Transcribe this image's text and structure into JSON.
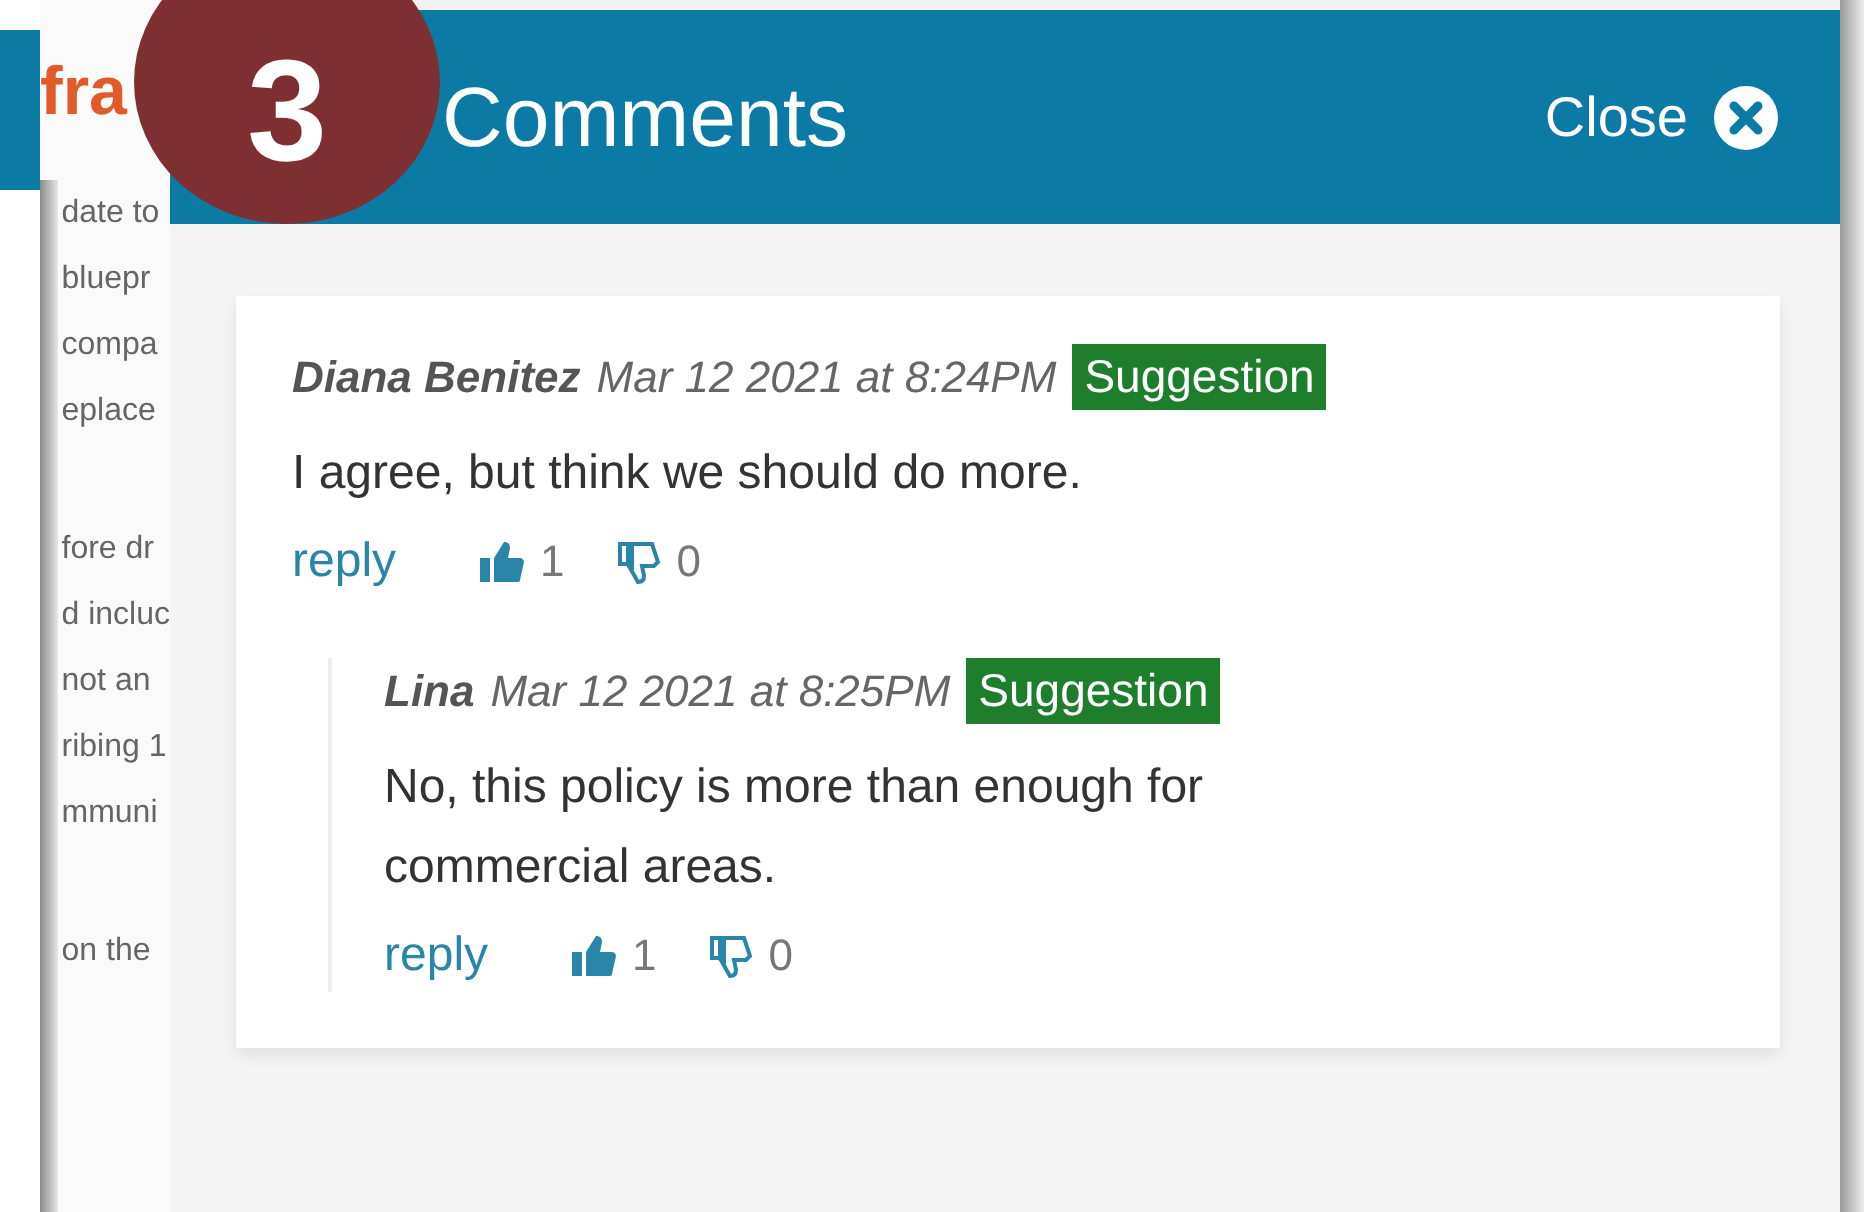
{
  "background_page": {
    "heading": "fra",
    "paragraphs": [
      {
        "lines": [
          "date to",
          "bluepr",
          "compa",
          "eplace"
        ]
      },
      {
        "lines": [
          "fore dr",
          "d incluc",
          "not an",
          "ribing 1",
          "mmuni"
        ]
      },
      {
        "lines": [
          "on the"
        ]
      }
    ]
  },
  "step_badge": "3",
  "panel": {
    "title": "Comments",
    "close_label": "Close"
  },
  "comments": [
    {
      "author": "Diana Benitez",
      "time": "Mar 12 2021 at 8:24PM",
      "tag": "Suggestion",
      "text": "I agree, but think we should do more.",
      "reply": "reply",
      "likes": "1",
      "dislikes": "0",
      "children": [
        {
          "author": "Lina",
          "time": "Mar 12 2021 at 8:25PM",
          "tag": "Suggestion",
          "text": "No, this policy is more than enough for commercial areas.",
          "reply": "reply",
          "likes": "1",
          "dislikes": "0"
        }
      ]
    }
  ]
}
